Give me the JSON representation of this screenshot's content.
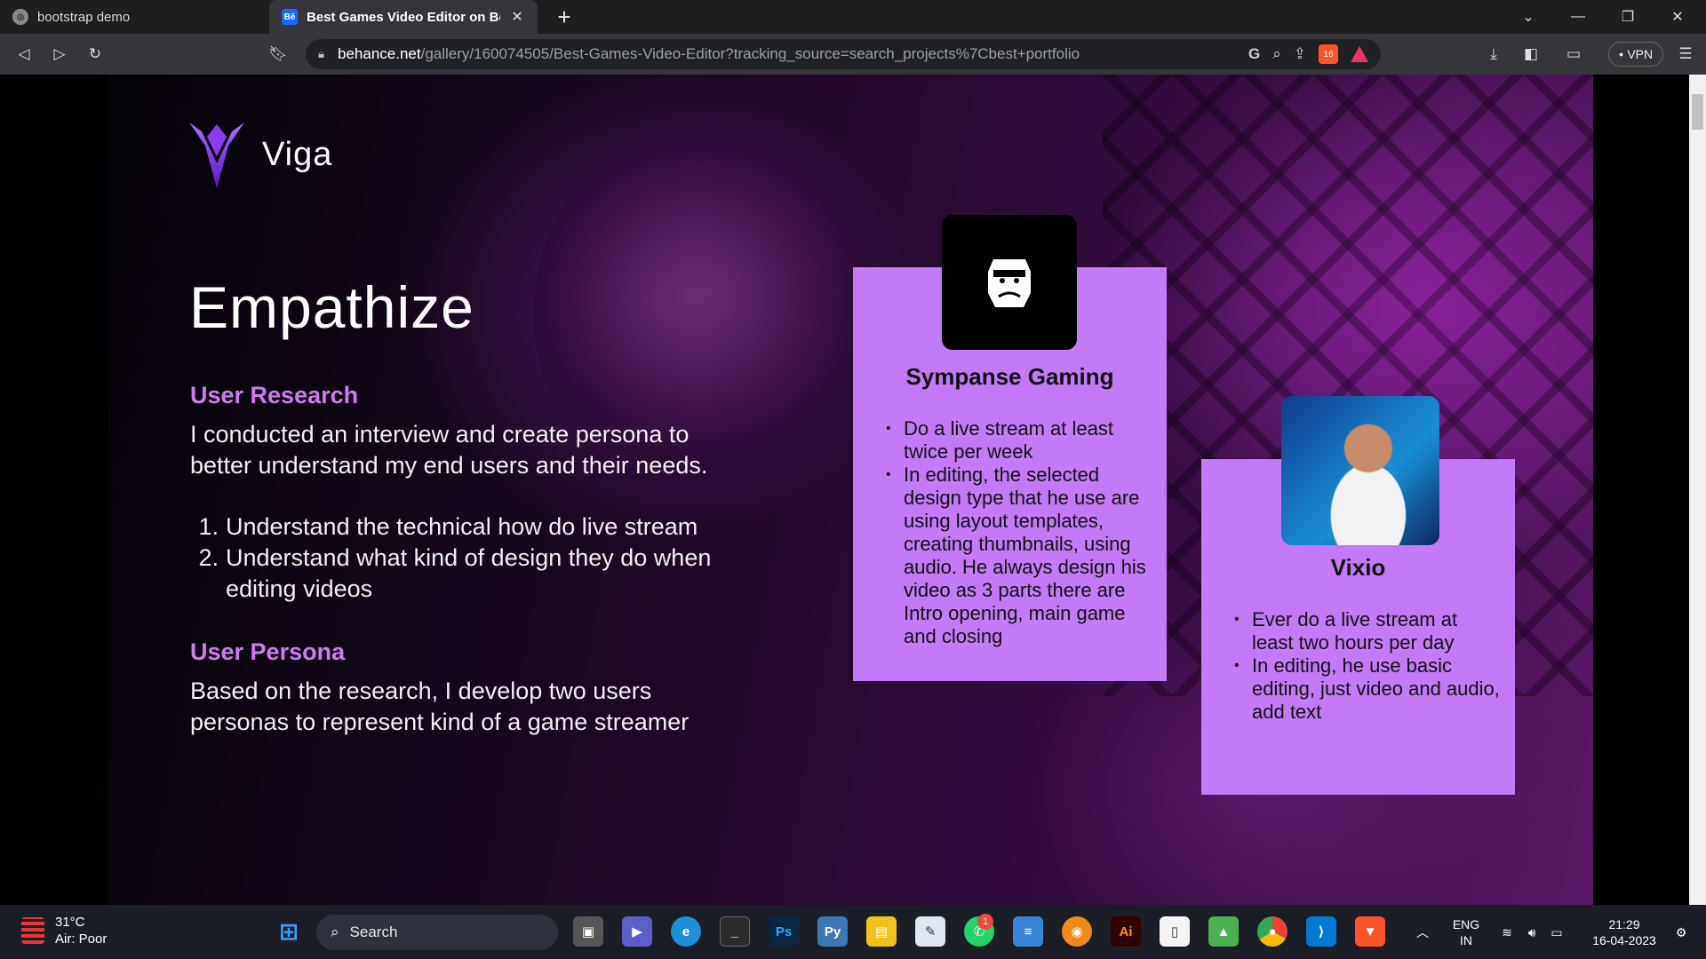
{
  "browser": {
    "tabs": [
      {
        "title": "bootstrap demo",
        "favicon": "globe-icon"
      },
      {
        "title": "Best Games Video Editor on Beha",
        "favicon": "behance-icon",
        "favicon_text": "Bē"
      }
    ],
    "url_host": "behance.net",
    "url_path": "/gallery/160074505/Best-Games-Video-Editor?tracking_source=search_projects%7Cbest+portfolio",
    "brave_shield_count": "16",
    "vpn_label": "VPN"
  },
  "page": {
    "logo_text": "Viga",
    "heading": "Empathize",
    "user_research": {
      "title": "User Research",
      "text": "I conducted an interview and create persona to better understand my end users and their needs.",
      "items": [
        {
          "num": "1.",
          "text": "Understand the technical how do live stream"
        },
        {
          "num": "2.",
          "text": "Understand what kind of design they do when editing videos"
        }
      ]
    },
    "user_persona": {
      "title": "User Persona",
      "text": "Based on the research, I develop two users personas to represent kind of a game streamer"
    },
    "personas": [
      {
        "name": "Sympanse Gaming",
        "avatar": "gorilla-icon",
        "bullets": [
          "Do a live stream at least twice per week",
          "In editing, the selected design  type that he use are using layout templates, creating thumbnails, using audio. He always design his video as 3 parts there are Intro opening, main game and closing"
        ]
      },
      {
        "name": "Vixio",
        "avatar": "streamer-photo",
        "bullets": [
          "Ever do a live stream at least two hours per day",
          "In editing, he use basic editing, just video and audio, add text"
        ]
      }
    ],
    "accent_color": "#d07af0",
    "card_color": "#c479f7"
  },
  "taskbar": {
    "weather_temp": "31°C",
    "weather_desc": "Air: Poor",
    "search_label": "Search",
    "whatsapp_badge": "1",
    "lang_line1": "ENG",
    "lang_line2": "IN",
    "time": "21:29",
    "date": "16-04-2023"
  }
}
